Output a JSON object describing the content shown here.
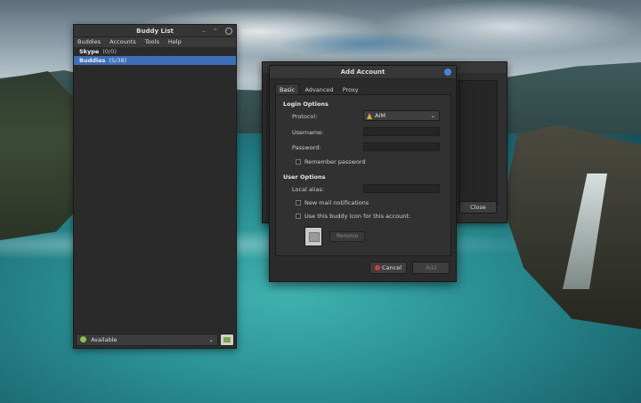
{
  "buddy_list": {
    "title": "Buddy List",
    "menu": [
      "Buddies",
      "Accounts",
      "Tools",
      "Help"
    ],
    "groups": [
      {
        "name": "Skype",
        "count": "(0/0)",
        "selected": false
      },
      {
        "name": "Buddies",
        "count": "(5/38)",
        "selected": true
      }
    ],
    "status": "Available",
    "status_color": "#8cc34a"
  },
  "accounts_window": {
    "close_label": "Close"
  },
  "add_account": {
    "title": "Add Account",
    "tabs": [
      "Basic",
      "Advanced",
      "Proxy"
    ],
    "active_tab": "Basic",
    "login_options": "Login Options",
    "protocol_label": "Protocol:",
    "protocol_value": "AIM",
    "username_label": "Username:",
    "password_label": "Password:",
    "remember_label": "Remember password",
    "user_options": "User Options",
    "alias_label": "Local alias:",
    "new_mail_label": "New mail notifications",
    "buddy_icon_label": "Use this buddy icon for this account:",
    "remove_label": "Remove",
    "cancel_label": "Cancel",
    "add_label": "Add"
  },
  "colors": {
    "selection": "#3d6fb8",
    "accent_info": "#3f86e0",
    "cancel_icon": "#d63b3b"
  }
}
